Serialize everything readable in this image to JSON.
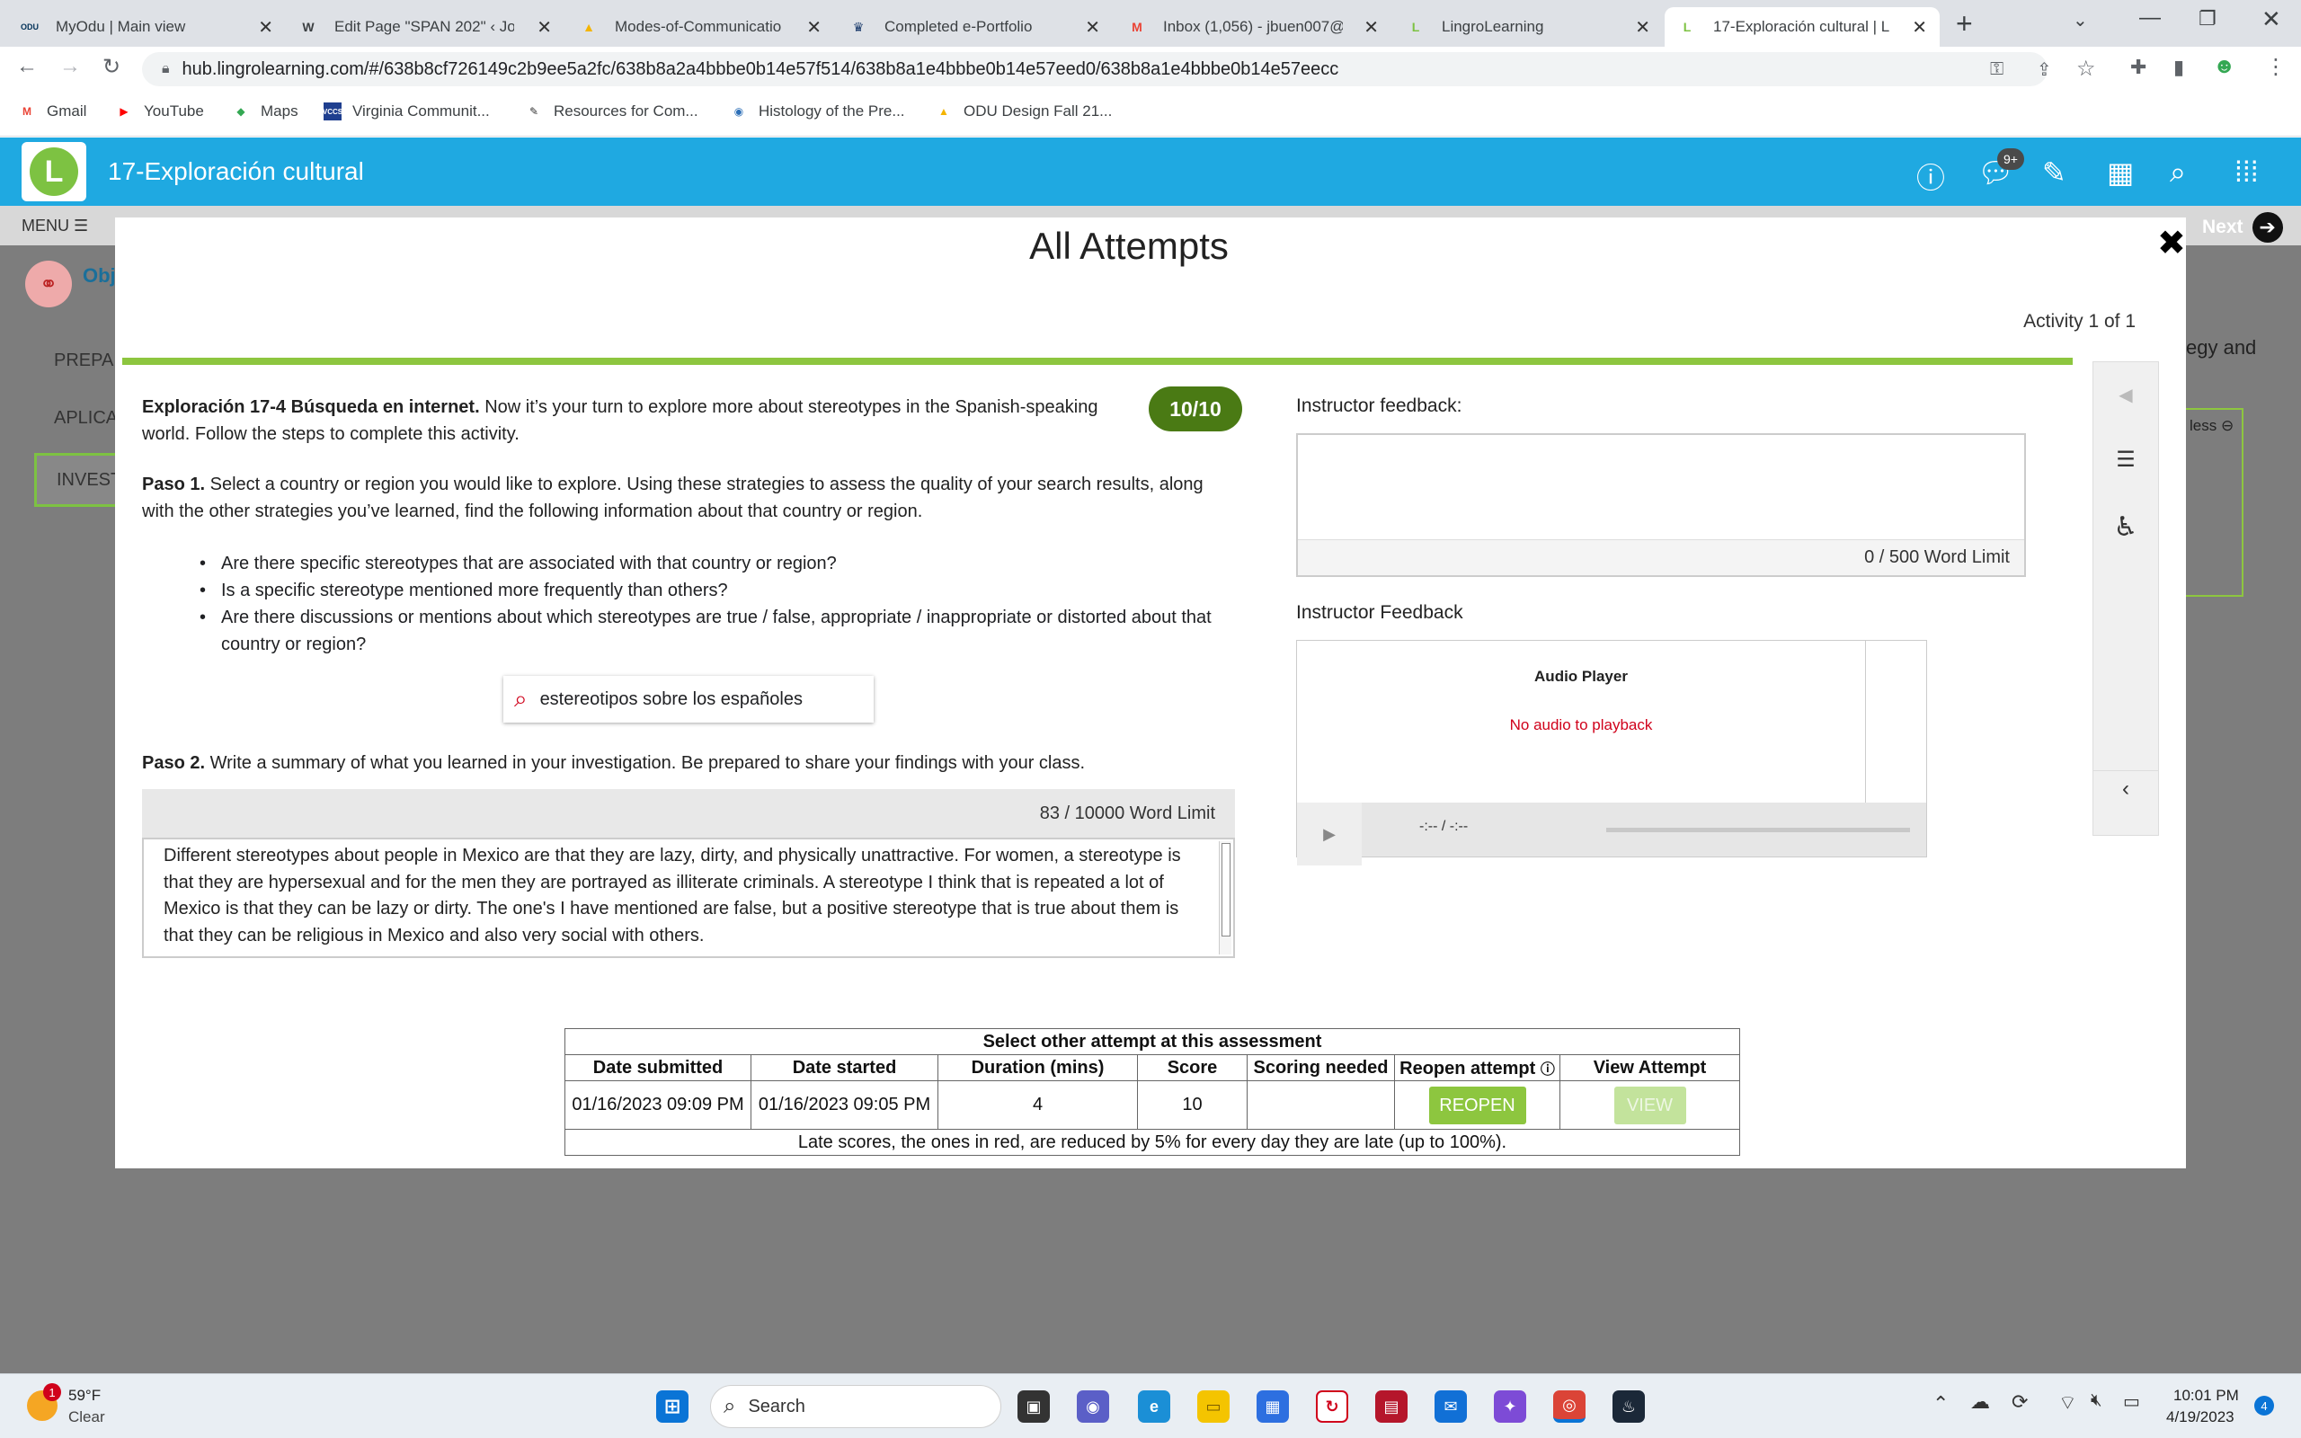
{
  "tabs": [
    {
      "label": "MyOdu | Main view",
      "icon": "odu-icon",
      "glyph": "ODU",
      "color": "#003057"
    },
    {
      "label": "Edit Page \"SPAN 202\" ‹ Jor",
      "icon": "wordpress-icon",
      "glyph": "W",
      "color": "#3c4043"
    },
    {
      "label": "Modes-of-Communicatio",
      "icon": "google-drive-icon",
      "glyph": "▲",
      "color": "#f4b400"
    },
    {
      "label": "Completed e-Portfolio",
      "icon": "crown-icon",
      "glyph": "♛",
      "color": "#1a3a6b"
    },
    {
      "label": "Inbox (1,056) - jbuen007@",
      "icon": "gmail-icon",
      "glyph": "M",
      "color": "#ea4335"
    },
    {
      "label": "LingroLearning",
      "icon": "lingro-icon",
      "glyph": "L",
      "color": "#7dc242"
    },
    {
      "label": "17-Exploración cultural | L",
      "icon": "lingro-icon",
      "glyph": "L",
      "color": "#7dc242"
    }
  ],
  "url": "hub.lingrolearning.com/#/638b8cf726149c2b9ee5a2fc/638b8a2a4bbbe0b14e57f514/638b8a1e4bbbe0b14e57eed0/638b8a1e4bbbe0b14e57eecc",
  "bookmarks": [
    {
      "label": "Gmail",
      "glyph": "M",
      "color": "#ea4335"
    },
    {
      "label": "YouTube",
      "glyph": "▶",
      "color": "#ff0000"
    },
    {
      "label": "Maps",
      "glyph": "◆",
      "color": "#34a853"
    },
    {
      "label": "Virginia Communit...",
      "glyph": "VCCS",
      "color": "#1f3f8f"
    },
    {
      "label": "Resources for Com...",
      "glyph": "✎",
      "color": "#333"
    },
    {
      "label": "Histology of the Pre...",
      "glyph": "◉",
      "color": "#2d6fb7"
    },
    {
      "label": "ODU Design Fall 21...",
      "glyph": "▲",
      "color": "#f4b400"
    }
  ],
  "app": {
    "title": "17-Exploración cultural",
    "menu_label": "MENU ☰",
    "next_label": "Next",
    "bg_left_labels": [
      "Obj",
      "PREPA",
      "APLICA",
      "INVEST"
    ],
    "bg_right_text": "egy and",
    "bg_right_less": "less",
    "notif_badge": "9+"
  },
  "modal": {
    "title": "All Attempts",
    "activity_count": "Activity 1 of 1",
    "score_badge": "10/10",
    "intro_bold": "Exploración 17-4 Búsqueda en internet.",
    "intro_text": " Now it’s your turn to explore more about stereotypes in the Spanish-speaking world. Follow the steps to complete this activity.",
    "paso1_bold": "Paso 1.",
    "paso1_text": " Select a country or region you would like to explore. Using these strategies to assess the quality of your search results, along with the other strategies you’ve learned, find the following information about that country or region.",
    "bullets": [
      "Are there specific stereotypes that are associated with that country or region?",
      "Is a specific stereotype mentioned more frequently than others?",
      "Are there discussions or mentions about which stereotypes are true / false, appropriate / inappropriate or distorted about that country or region?"
    ],
    "search_query": "estereotipos sobre los españoles",
    "paso2_bold": "Paso 2.",
    "paso2_text": " Write a summary of what you learned in your investigation. Be prepared to share your findings with your class.",
    "summary_word_limit": "83 /  10000 Word Limit",
    "summary_text": "Different stereotypes about people in Mexico are that they are lazy, dirty, and physically unattractive. For women, a stereotype is that they are hypersexual and for the men they are portrayed as illiterate criminals. A stereotype I think that is repeated a lot of Mexico is that they can be lazy or dirty. The one's I have mentioned are false, but a positive stereotype that is true about them is that they can be religious in Mexico and also very social with others.",
    "instructor_feedback_label": "Instructor feedback:",
    "feedback_word_limit": "0  / 500 Word Limit",
    "instructor_audio_label": "Instructor Feedback",
    "audio_header": "Audio Player",
    "audio_no_playback": "No audio to playback",
    "audio_time": "-:-- / -:--"
  },
  "attempts_table": {
    "caption": "Select other attempt at this assessment",
    "headers": [
      "Date submitted",
      "Date started",
      "Duration (mins)",
      "Score",
      "Scoring needed",
      "Reopen  attempt",
      "View Attempt"
    ],
    "row": [
      "01/16/2023 09:09 PM",
      "01/16/2023 09:05 PM",
      "4",
      "10",
      ""
    ],
    "reopen_label": "REOPEN",
    "view_label": "VIEW",
    "footnote": "Late scores, the ones in red, are reduced by 5% for every day they are late (up to 100%)."
  },
  "taskbar": {
    "weather_temp": "59°F",
    "weather_desc": "Clear",
    "weather_badge": "1",
    "search_label": "Search",
    "time": "10:01 PM",
    "date": "4/19/2023",
    "notif_count": "4"
  },
  "colors": {
    "brand": "#1fa9e1",
    "accent_green": "#8dc63f",
    "score_green": "#4a7a14",
    "error_red": "#d0021b"
  }
}
